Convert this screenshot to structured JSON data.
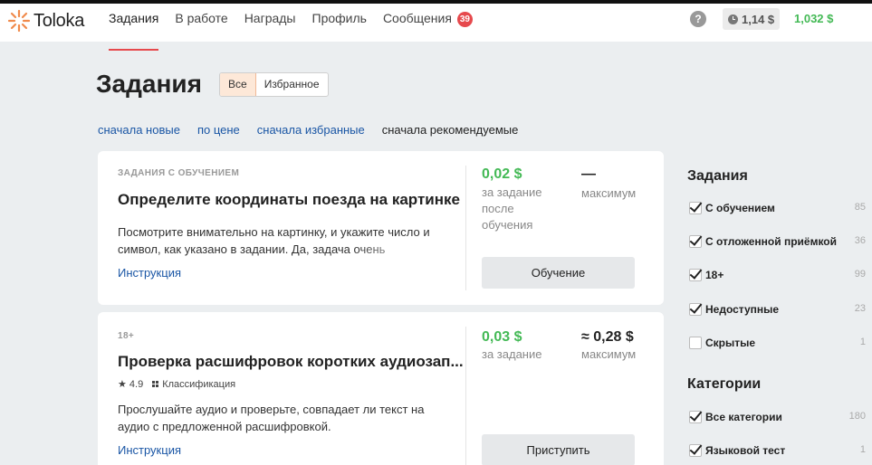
{
  "header": {
    "logo_text": "Toloka",
    "nav": [
      {
        "label": "Задания"
      },
      {
        "label": "В работе"
      },
      {
        "label": "Награды"
      },
      {
        "label": "Профиль"
      },
      {
        "label": "Сообщения",
        "badge": "39"
      }
    ],
    "help_glyph": "?",
    "pending_amount": "1,14 $",
    "balance": "1,032 $"
  },
  "page": {
    "title": "Задания",
    "filter": {
      "all": "Все",
      "favorites": "Избранное"
    },
    "sorts": [
      "сначала новые",
      "по цене",
      "сначала избранные",
      "сначала рекомендуемые"
    ]
  },
  "cards": [
    {
      "tag": "ЗАДАНИЯ С ОБУЧЕНИЕМ",
      "title": "Определите координаты поезда на картинке",
      "description": "Посмотрите внимательно на картинку, и укажите число и символ, как указано в задании. Да, задача очень непростая",
      "link": "Инструкция",
      "price": "0,02 $",
      "price_label": "за задание после обучения",
      "max": "—",
      "max_label": "максимум",
      "button": "Обучение"
    },
    {
      "tag": "18+",
      "title": "Проверка расшифровок коротких аудиозап...",
      "rating": "★ 4.9",
      "category": "Классификация",
      "description": "Прослушайте аудио и проверьте, совпадает ли текст на аудио с предложенной расшифровкой.",
      "link": "Инструкция",
      "price": "0,03 $",
      "price_label": "за задание",
      "max": "≈ 0,28 $",
      "max_label": "максимум",
      "button": "Приступить"
    }
  ],
  "sidebar": {
    "tasks_heading": "Задания",
    "tasks": [
      {
        "label": "С обучением",
        "count": "85",
        "checked": true
      },
      {
        "label": "С отложенной приёмкой",
        "count": "36",
        "checked": true
      },
      {
        "label": "18+",
        "count": "99",
        "checked": true
      },
      {
        "label": "Недоступные",
        "count": "23",
        "checked": true
      },
      {
        "label": "Скрытые",
        "count": "1",
        "checked": false
      }
    ],
    "categories_heading": "Категории",
    "categories": [
      {
        "label": "Все категории",
        "count": "180",
        "checked": true
      },
      {
        "label": "Языковой тест",
        "count": "1",
        "checked": true
      }
    ]
  },
  "colors": {
    "accent": "#e6494d",
    "money": "#43b955",
    "link": "#1a56a5"
  }
}
